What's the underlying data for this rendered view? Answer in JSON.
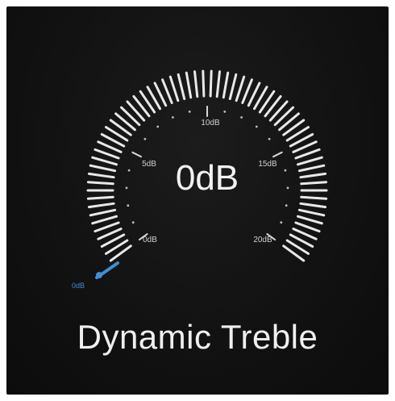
{
  "gauge": {
    "value_label": "0dB",
    "current_level": 0,
    "min_level": 0,
    "max_level": 20,
    "scale_labels": [
      "0dB",
      "5dB",
      "10dB",
      "15dB",
      "20dB"
    ],
    "start_label": "0dB",
    "active_color": "#3d8fd6",
    "tick_color": "#e8e8e8"
  },
  "control": {
    "title": "Dynamic Treble"
  }
}
